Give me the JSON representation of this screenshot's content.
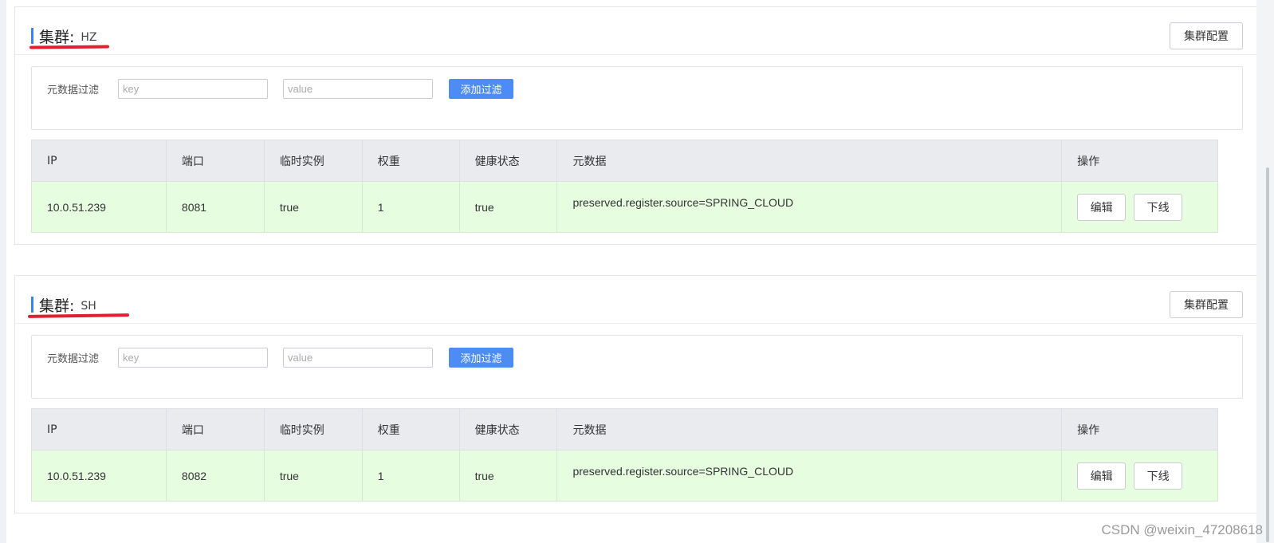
{
  "clusters": [
    {
      "title": "集群:",
      "name": "HZ",
      "config_button": "集群配置",
      "filter": {
        "label": "元数据过滤",
        "key_placeholder": "key",
        "value_placeholder": "value",
        "add_button": "添加过滤"
      },
      "table": {
        "headers": [
          "IP",
          "端口",
          "临时实例",
          "权重",
          "健康状态",
          "元数据",
          "操作"
        ],
        "rows": [
          {
            "ip": "10.0.51.239",
            "port": "8081",
            "ephemeral": "true",
            "weight": "1",
            "healthy": "true",
            "metadata": "preserved.register.source=SPRING_CLOUD",
            "edit": "编辑",
            "offline": "下线"
          }
        ]
      }
    },
    {
      "title": "集群:",
      "name": "SH",
      "config_button": "集群配置",
      "filter": {
        "label": "元数据过滤",
        "key_placeholder": "key",
        "value_placeholder": "value",
        "add_button": "添加过滤"
      },
      "table": {
        "headers": [
          "IP",
          "端口",
          "临时实例",
          "权重",
          "健康状态",
          "元数据",
          "操作"
        ],
        "rows": [
          {
            "ip": "10.0.51.239",
            "port": "8082",
            "ephemeral": "true",
            "weight": "1",
            "healthy": "true",
            "metadata": "preserved.register.source=SPRING_CLOUD",
            "edit": "编辑",
            "offline": "下线"
          }
        ]
      }
    }
  ],
  "watermark": "CSDN @weixin_47208618",
  "colors": {
    "accent": "#3b82f6",
    "add_button": "#4d8cf5",
    "row_bg": "#e6fde0",
    "header_bg": "#e9ebef",
    "annotation_red": "#e0202f"
  }
}
